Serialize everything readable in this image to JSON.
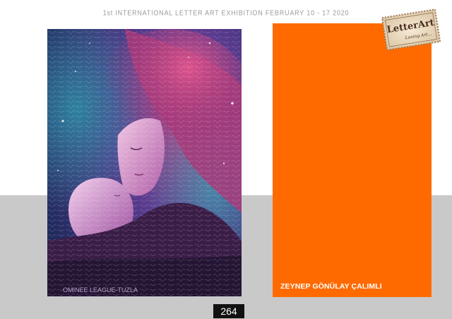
{
  "header": {
    "title": "1st INTERNATIONAL LETTER ART EXHIBITION FEBRUARY 10 - 17 2020"
  },
  "logo": {
    "text": "LetterArt",
    "tagline": "Loving Art..."
  },
  "artwork": {
    "signature": "OMINEE LEAGUE-TUZLA"
  },
  "panel": {
    "artist_name": "ZEYNEP GÖNÜLAY ÇALIMLI",
    "color": "#ff6a00"
  },
  "page": {
    "number": "264"
  }
}
